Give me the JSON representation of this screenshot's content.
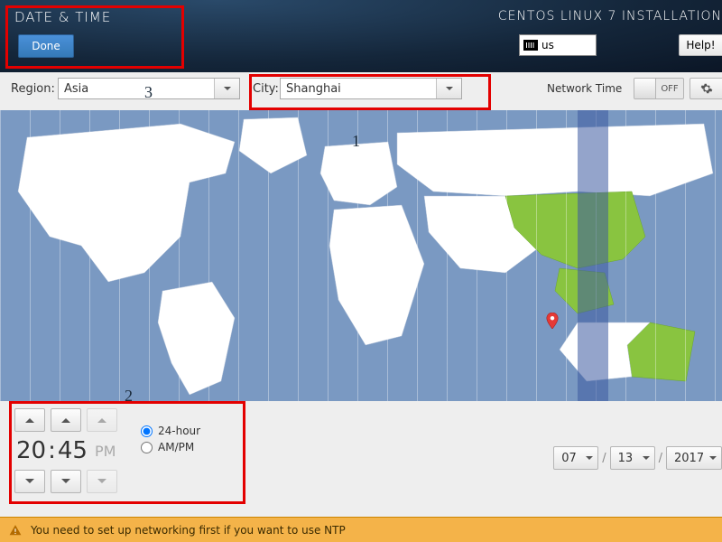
{
  "header": {
    "title": "DATE & TIME",
    "install_title": "CENTOS LINUX 7 INSTALLATION",
    "done_label": "Done",
    "keyboard_layout": "us",
    "help_label": "Help!"
  },
  "selectors": {
    "region_label": "Region:",
    "region_value": "Asia",
    "city_label": "City:",
    "city_value": "Shanghai",
    "network_time_label": "Network Time",
    "network_time_state": "OFF"
  },
  "map": {
    "selected_timezone": "Asia/Shanghai",
    "highlight_color": "#8bc34a"
  },
  "time": {
    "hours": "20",
    "minutes": "45",
    "ampm": "PM",
    "format_24_label": "24-hour",
    "format_ampm_label": "AM/PM",
    "format_selected": "24-hour"
  },
  "date": {
    "month": "07",
    "day": "13",
    "year": "2017",
    "sep": "/"
  },
  "footer": {
    "warning": "You need to set up networking first if you want to use NTP"
  },
  "annotations": {
    "n1": "1",
    "n2": "2",
    "n3": "3"
  }
}
